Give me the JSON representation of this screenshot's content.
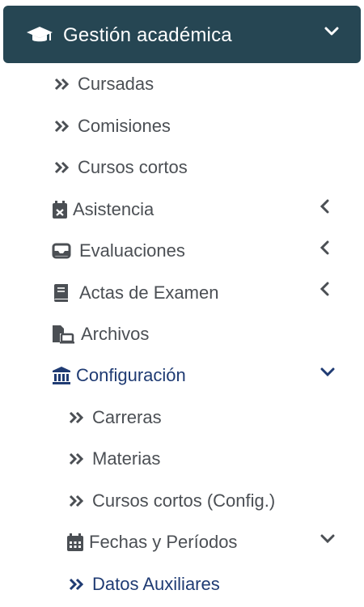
{
  "header": {
    "title": "Gestión académica",
    "icon": "graduation-cap-icon",
    "chevron": "chevron-down-icon",
    "bg_color": "#264653"
  },
  "menu": {
    "cursadas": "Cursadas",
    "comisiones": "Comisiones",
    "cursos_cortos": "Cursos cortos",
    "asistencia": "Asistencia",
    "evaluaciones": "Evaluaciones",
    "actas": "Actas de Examen",
    "archivos": "Archivos",
    "configuracion": "Configuración",
    "carreras": "Carreras",
    "materias": "Materias",
    "cursos_cortos_config": "Cursos cortos (Config.)",
    "fechas": "Fechas y Períodos",
    "datos_auxiliares": "Datos Auxiliares"
  },
  "colors": {
    "text": "#4b4f54",
    "active": "#1f3b73"
  }
}
